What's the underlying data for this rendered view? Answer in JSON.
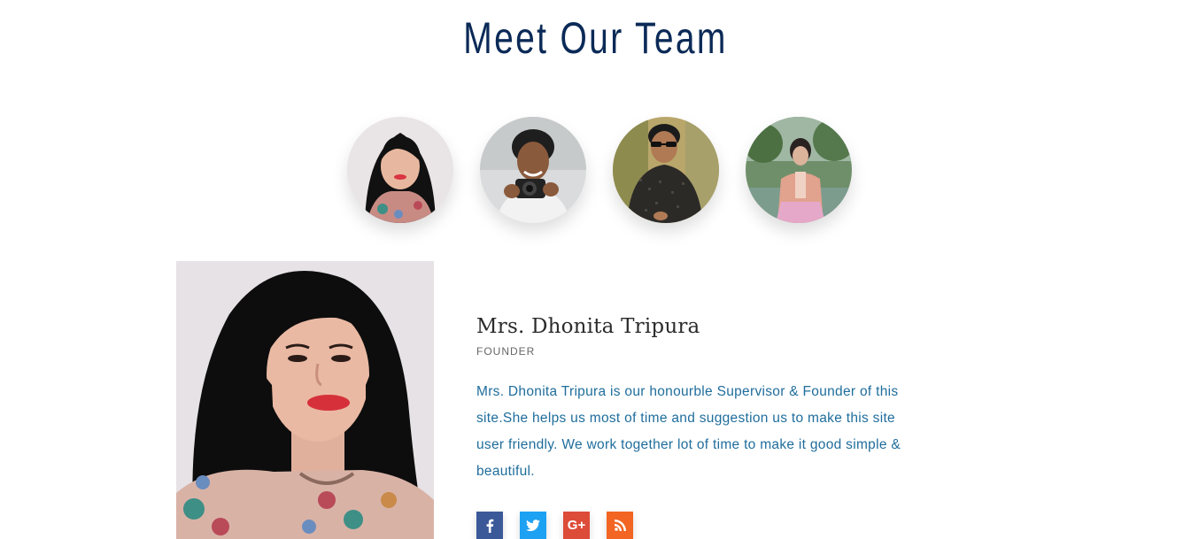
{
  "section": {
    "title": "Meet Our Team"
  },
  "team": [
    {
      "name": "Mrs. Dhonita Tripura",
      "avatar_icon": "woman-portrait-icon"
    },
    {
      "name": "",
      "avatar_icon": "man-with-camera-icon"
    },
    {
      "name": "",
      "avatar_icon": "man-with-sunglasses-icon"
    },
    {
      "name": "",
      "avatar_icon": "woman-outdoors-icon"
    }
  ],
  "selected": {
    "name": "Mrs. Dhonita Tripura",
    "role": "FOUNDER",
    "bio": "Mrs. Dhonita Tripura is our honourble Supervisor & Founder of this site.She helps us most of time and suggestion us to make this site user friendly. We work together lot of time to make it good simple & beautiful."
  },
  "socials": [
    {
      "label": "f",
      "icon": "facebook-icon",
      "color": "#3b5998"
    },
    {
      "label": "t",
      "icon": "twitter-icon",
      "color": "#1da1f2"
    },
    {
      "label": "G+",
      "icon": "google-plus-icon",
      "color": "#dd4b39"
    },
    {
      "label": "rss",
      "icon": "rss-icon",
      "color": "#f26522"
    }
  ],
  "colors": {
    "title": "#0b2a57",
    "bio": "#1f6d9c"
  }
}
